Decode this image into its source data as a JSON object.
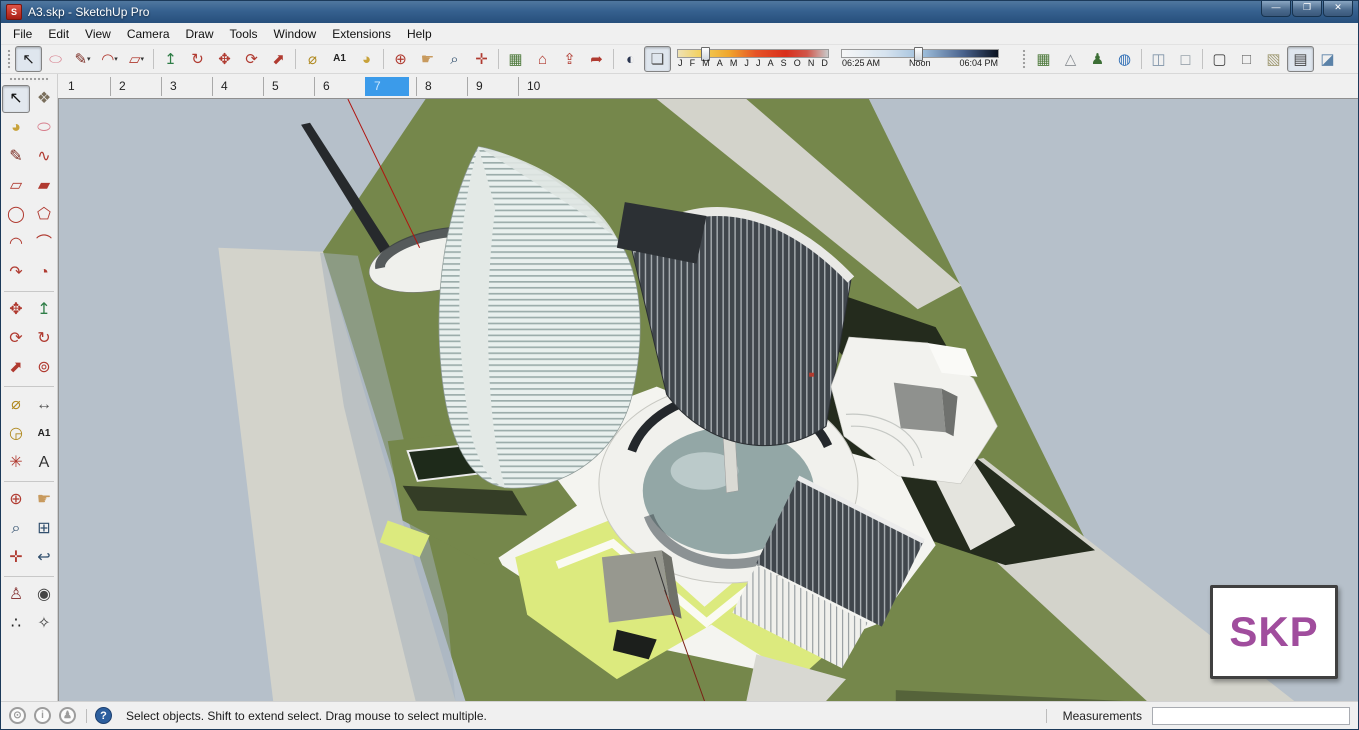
{
  "window": {
    "title": "A3.skp - SketchUp Pro",
    "app_icon_letter": "S",
    "controls": [
      {
        "name": "minimize-button",
        "glyph": "—"
      },
      {
        "name": "maximize-button",
        "glyph": "❐"
      },
      {
        "name": "close-button",
        "glyph": "✕"
      }
    ]
  },
  "menu": {
    "items": [
      "File",
      "Edit",
      "View",
      "Camera",
      "Draw",
      "Tools",
      "Window",
      "Extensions",
      "Help"
    ]
  },
  "toolbar": {
    "dropdown_glyph": "▾",
    "items_left": [
      {
        "handle": true,
        "name": "toolbar-drag-handle"
      },
      {
        "name": "select-tool",
        "glyph": "↖",
        "color": "#1a1a1a",
        "pressed": true
      },
      {
        "name": "eraser-tool",
        "glyph": "⬭",
        "color": "#d77f8d"
      },
      {
        "name": "line-tool",
        "glyph": "✎",
        "color": "#7a2b22",
        "dropdown": true
      },
      {
        "name": "arc-tool",
        "glyph": "◠",
        "color": "#b03a30",
        "dropdown": true
      },
      {
        "name": "rectangle-tool",
        "glyph": "▱",
        "color": "#b03a30",
        "dropdown": true
      },
      {
        "sep": true,
        "name": "toolbar-separator"
      },
      {
        "name": "push-pull-tool",
        "glyph": "↥",
        "color": "#2e7d46"
      },
      {
        "name": "follow-me-tool",
        "glyph": "↻",
        "color": "#b03a30"
      },
      {
        "name": "move-tool",
        "glyph": "✥",
        "color": "#b03a30"
      },
      {
        "name": "rotate-tool",
        "glyph": "⟳",
        "color": "#b03a30"
      },
      {
        "name": "scale-tool",
        "glyph": "⬈",
        "color": "#b03a30"
      },
      {
        "sep": true,
        "name": "toolbar-separator"
      },
      {
        "name": "tape-measure-tool",
        "glyph": "⌀",
        "color": "#b0891f"
      },
      {
        "name": "text-tool",
        "glyph": "A1",
        "color": "#222222"
      },
      {
        "name": "paint-bucket-tool",
        "glyph": "◕",
        "color": "#c8a23a"
      },
      {
        "sep": true,
        "name": "toolbar-separator"
      },
      {
        "name": "orbit-tool",
        "glyph": "⊕",
        "color": "#b03a30"
      },
      {
        "name": "pan-tool",
        "glyph": "☛",
        "color": "#c89a5e"
      },
      {
        "name": "zoom-tool",
        "glyph": "⌕",
        "color": "#32506e"
      },
      {
        "name": "zoom-extents-tool",
        "glyph": "✛",
        "color": "#b03a30"
      },
      {
        "sep": true,
        "name": "toolbar-separator"
      },
      {
        "name": "add-location-button",
        "glyph": "▦",
        "color": "#4e7a3c"
      },
      {
        "name": "get-models-button",
        "glyph": "⌂",
        "color": "#b03a30"
      },
      {
        "name": "share-model-button",
        "glyph": "⇪",
        "color": "#b03a30"
      },
      {
        "name": "send-to-layout-button",
        "glyph": "➦",
        "color": "#b03a30"
      },
      {
        "sep": true,
        "name": "toolbar-separator"
      },
      {
        "name": "shadow-settings-button",
        "glyph": "◐",
        "color": "#2a3550"
      },
      {
        "name": "shadow-toggle-button",
        "glyph": "❏",
        "color": "#555555",
        "pressed": true
      }
    ],
    "items_right": [
      {
        "handle": true,
        "name": "toolbar-drag-handle"
      },
      {
        "name": "add-location-button",
        "glyph": "▦",
        "color": "#4e7a3c"
      },
      {
        "name": "toggle-terrain-button",
        "glyph": "△",
        "color": "#8a8f94"
      },
      {
        "name": "photo-textures-button",
        "glyph": "♟",
        "color": "#3c6e35"
      },
      {
        "name": "google-earth-button",
        "glyph": "◍",
        "color": "#2d6db5"
      },
      {
        "sep": true,
        "name": "toolbar-separator"
      },
      {
        "name": "xray-style-button",
        "glyph": "◫",
        "color": "#7f93a8"
      },
      {
        "name": "back-edges-style-button",
        "glyph": "◻",
        "color": "#9aa4ad"
      },
      {
        "sep": true,
        "name": "toolbar-separator"
      },
      {
        "name": "wireframe-style-button",
        "glyph": "▢",
        "color": "#444444"
      },
      {
        "name": "hidden-line-style-button",
        "glyph": "□",
        "color": "#666666"
      },
      {
        "name": "shaded-style-button",
        "glyph": "▧",
        "color": "#a09a74"
      },
      {
        "name": "shaded-textures-style-button",
        "glyph": "▤",
        "color": "#444444",
        "pressed": true
      },
      {
        "name": "monochrome-style-button",
        "glyph": "◪",
        "color": "#5b82a8"
      }
    ]
  },
  "shadow_toolbar": {
    "months": [
      "J",
      "F",
      "M",
      "A",
      "M",
      "J",
      "J",
      "A",
      "S",
      "O",
      "N",
      "D"
    ],
    "month_handle_pos": "16%",
    "times": [
      "06:25 AM",
      "Noon",
      "06:04 PM"
    ],
    "time_handle_pos": "46%"
  },
  "scene_tabs": {
    "tabs": [
      {
        "label": "1"
      },
      {
        "label": "2"
      },
      {
        "label": "3"
      },
      {
        "label": "4"
      },
      {
        "label": "5"
      },
      {
        "label": "6"
      },
      {
        "label": "7",
        "active": true
      },
      {
        "label": "8"
      },
      {
        "label": "9"
      },
      {
        "label": "10"
      }
    ]
  },
  "large_tool_set": [
    {
      "name": "select-tool",
      "glyph": "↖",
      "color": "#111111",
      "pressed": true
    },
    {
      "name": "make-component-tool",
      "glyph": "❖",
      "color": "#7a6f5c"
    },
    {
      "name": "paint-bucket-tool",
      "glyph": "◕",
      "color": "#c8a23a"
    },
    {
      "name": "eraser-tool",
      "glyph": "⬭",
      "color": "#d77f8d"
    },
    {
      "name": "line-tool",
      "glyph": "✎",
      "color": "#7a2b22"
    },
    {
      "name": "freehand-tool",
      "glyph": "∿",
      "color": "#b03a30"
    },
    {
      "name": "rectangle-tool",
      "glyph": "▱",
      "color": "#b03a30"
    },
    {
      "name": "rotated-rectangle-tool",
      "glyph": "▰",
      "color": "#b03a30"
    },
    {
      "name": "circle-tool",
      "glyph": "◯",
      "color": "#b03a30"
    },
    {
      "name": "polygon-tool",
      "glyph": "⬠",
      "color": "#b03a30"
    },
    {
      "name": "arc-tool",
      "glyph": "◠",
      "color": "#b03a30"
    },
    {
      "name": "two-point-arc-tool",
      "glyph": "⌒",
      "color": "#b03a30"
    },
    {
      "name": "three-point-arc-tool",
      "glyph": "↷",
      "color": "#b03a30"
    },
    {
      "name": "pie-tool",
      "glyph": "◔",
      "color": "#b03a30"
    },
    {
      "divider": true,
      "name": "tool-group-divider"
    },
    {
      "name": "move-tool",
      "glyph": "✥",
      "color": "#b03a30"
    },
    {
      "name": "push-pull-tool",
      "glyph": "↥",
      "color": "#2e7d46"
    },
    {
      "name": "rotate-tool",
      "glyph": "⟳",
      "color": "#b03a30"
    },
    {
      "name": "follow-me-tool",
      "glyph": "↻",
      "color": "#b03a30"
    },
    {
      "name": "scale-tool",
      "glyph": "⬈",
      "color": "#b03a30"
    },
    {
      "name": "offset-tool",
      "glyph": "⊚",
      "color": "#b03a30"
    },
    {
      "divider": true,
      "name": "tool-group-divider"
    },
    {
      "name": "tape-measure-tool",
      "glyph": "⌀",
      "color": "#b0891f"
    },
    {
      "name": "dimension-tool",
      "glyph": "↔",
      "color": "#555555"
    },
    {
      "name": "protractor-tool",
      "glyph": "◶",
      "color": "#b0891f"
    },
    {
      "name": "text-tool",
      "glyph": "A1",
      "color": "#222222"
    },
    {
      "name": "axes-tool",
      "glyph": "✳",
      "color": "#b03a30"
    },
    {
      "name": "3d-text-tool",
      "glyph": "A",
      "color": "#333333"
    },
    {
      "divider": true,
      "name": "tool-group-divider"
    },
    {
      "name": "orbit-tool",
      "glyph": "⊕",
      "color": "#b03a30"
    },
    {
      "name": "pan-tool",
      "glyph": "☛",
      "color": "#c89a5e"
    },
    {
      "name": "zoom-tool",
      "glyph": "⌕",
      "color": "#32506e"
    },
    {
      "name": "zoom-window-tool",
      "glyph": "⊞",
      "color": "#32506e"
    },
    {
      "name": "zoom-extents-tool",
      "glyph": "✛",
      "color": "#b03a30"
    },
    {
      "name": "zoom-previous-tool",
      "glyph": "↩",
      "color": "#32506e"
    },
    {
      "divider": true,
      "name": "tool-group-divider"
    },
    {
      "name": "position-camera-tool",
      "glyph": "♙",
      "color": "#8a3b3b"
    },
    {
      "name": "look-around-tool",
      "glyph": "◉",
      "color": "#444444"
    },
    {
      "name": "walk-tool",
      "glyph": "∴",
      "color": "#222222"
    },
    {
      "name": "navigation-compass-tool",
      "glyph": "✧",
      "color": "#444444"
    }
  ],
  "viewport": {
    "colors": {
      "sky": "#b6c0ca",
      "grass": "#75874b",
      "grass_bright": "#dcea7e",
      "shadow": "#242b1d",
      "road": "#d3d3cb",
      "road_shadow": "#a3b0bc",
      "plaza": "#f4f4f0",
      "white": "#f2f2ee",
      "dome": "#93a7a6",
      "axis_red": "#b01510"
    }
  },
  "watermark": {
    "text": "SKP",
    "color": "#a04d9d"
  },
  "statusbar": {
    "icons": [
      {
        "name": "geolocation-icon",
        "glyph": "⊙"
      },
      {
        "name": "credits-icon",
        "glyph": "i"
      },
      {
        "name": "user-icon",
        "glyph": "♟"
      }
    ],
    "help_glyph": "?",
    "message": "Select objects. Shift to extend select. Drag mouse to select multiple.",
    "measurements_label": "Measurements",
    "measurements_value": ""
  }
}
